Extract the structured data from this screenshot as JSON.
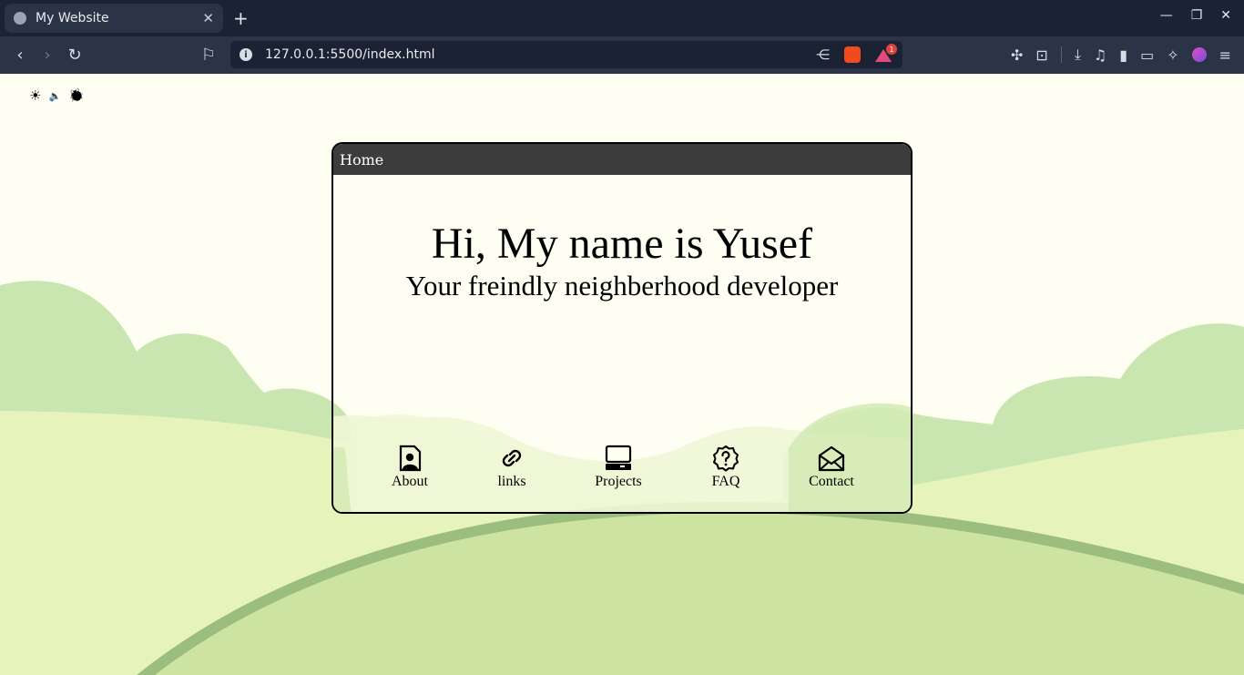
{
  "browser": {
    "tab_title": "My Website",
    "tab_close": "✕",
    "new_tab": "+",
    "url": "127.0.0.1:5500/index.html",
    "win_minimize": "—",
    "win_restore": "❐",
    "win_close": "✕",
    "badge_count": "1"
  },
  "page": {
    "toggles": {
      "theme": "☀",
      "sound": "🔈",
      "debug": "🐞"
    },
    "window_title": "Home",
    "heading": "Hi, My name is Yusef",
    "subheading": "Your freindly neighberhood developer",
    "nav": [
      {
        "label": "About",
        "icon": "person-file-icon"
      },
      {
        "label": "links",
        "icon": "link-icon"
      },
      {
        "label": "Projects",
        "icon": "computer-icon"
      },
      {
        "label": "FAQ",
        "icon": "question-badge-icon"
      },
      {
        "label": "Contact",
        "icon": "envelope-open-icon"
      }
    ]
  },
  "colors": {
    "background": "#fffef2",
    "hill_light": "#e6f3bb",
    "hill_mid": "#c9e6b0",
    "hill_dark": "#9bbd7e",
    "window_bar": "#3c3c3c"
  }
}
